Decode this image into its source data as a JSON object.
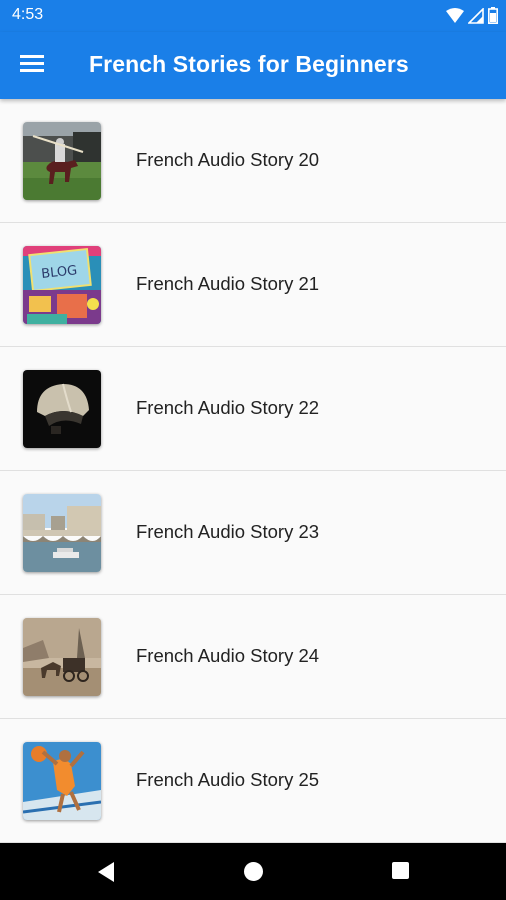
{
  "status_bar": {
    "time": "4:53",
    "icons": [
      "wifi-icon",
      "signal-icon",
      "battery-icon"
    ]
  },
  "app_bar": {
    "title": "French Stories for Beginners",
    "menu_icon": "menu-icon",
    "color": "#1a7fe8"
  },
  "stories": [
    {
      "label": "French Audio Story 20",
      "thumbnail": "knight-on-horse"
    },
    {
      "label": "French Audio Story 21",
      "thumbnail": "blog-illustration"
    },
    {
      "label": "French Audio Story 22",
      "thumbnail": "helmet"
    },
    {
      "label": "French Audio Story 23",
      "thumbnail": "paris-bridge"
    },
    {
      "label": "French Audio Story 24",
      "thumbnail": "horse-carriage-painting"
    },
    {
      "label": "French Audio Story 25",
      "thumbnail": "basketball-player"
    }
  ],
  "nav_bar": {
    "buttons": [
      "back-icon",
      "home-icon",
      "recents-icon"
    ]
  }
}
